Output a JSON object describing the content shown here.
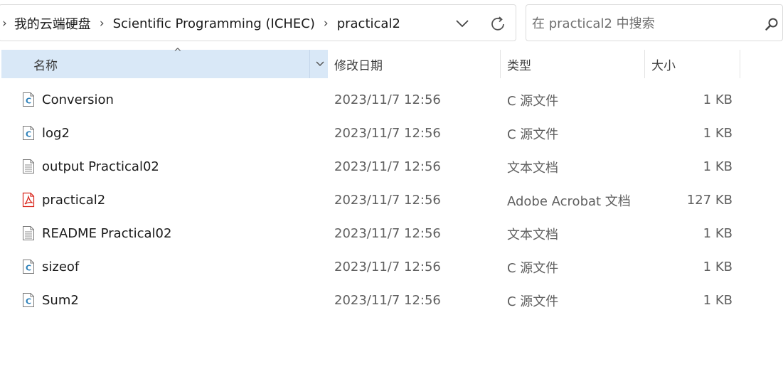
{
  "breadcrumb": {
    "items": [
      "我的云端硬盘",
      "Scientific Programming (ICHEC)",
      "practical2"
    ]
  },
  "search": {
    "placeholder": "在 practical2 中搜索"
  },
  "columns": {
    "name": "名称",
    "date": "修改日期",
    "type": "类型",
    "size": "大小"
  },
  "files": [
    {
      "name": "Conversion",
      "date": "2023/11/7 12:56",
      "type": "C 源文件",
      "size": "1 KB",
      "icon": "c-source-file-icon"
    },
    {
      "name": "log2",
      "date": "2023/11/7 12:56",
      "type": "C 源文件",
      "size": "1 KB",
      "icon": "c-source-file-icon"
    },
    {
      "name": "output Practical02",
      "date": "2023/11/7 12:56",
      "type": "文本文档",
      "size": "1 KB",
      "icon": "text-file-icon"
    },
    {
      "name": "practical2",
      "date": "2023/11/7 12:56",
      "type": "Adobe Acrobat 文档",
      "size": "127 KB",
      "icon": "pdf-file-icon"
    },
    {
      "name": "README Practical02",
      "date": "2023/11/7 12:56",
      "type": "文本文档",
      "size": "1 KB",
      "icon": "text-file-icon"
    },
    {
      "name": "sizeof",
      "date": "2023/11/7 12:56",
      "type": "C 源文件",
      "size": "1 KB",
      "icon": "c-source-file-icon"
    },
    {
      "name": "Sum2",
      "date": "2023/11/7 12:56",
      "type": "C 源文件",
      "size": "1 KB",
      "icon": "c-source-file-icon"
    }
  ],
  "colors": {
    "header_selected": "#d9e8f7",
    "c_icon_accent": "#2b7fb8",
    "pdf_icon_accent": "#d9261c",
    "secondary_text": "#5f5f5f"
  }
}
